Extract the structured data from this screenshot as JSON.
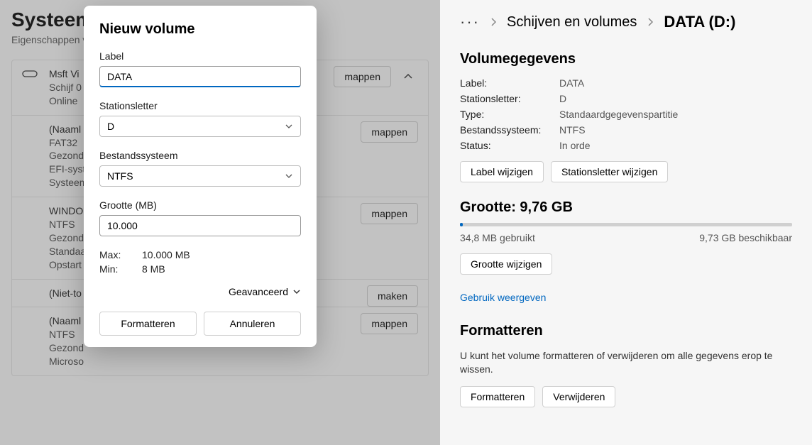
{
  "left": {
    "title": "Systeem                           volumes",
    "subtitle": "Eigenschappen v",
    "disks": [
      {
        "name": "Msft Vi",
        "lines": [
          "Schijf 0",
          "Online"
        ],
        "action": "mappen",
        "expandable": true,
        "icon": true
      },
      {
        "name": "(Naaml",
        "lines": [
          "FAT32",
          "Gezond",
          "EFI-syst",
          "Systeem"
        ],
        "action": "mappen"
      },
      {
        "name": "WINDO",
        "lines": [
          "NTFS",
          "Gezond",
          "Standaa",
          "Opstart"
        ],
        "action": "mappen"
      },
      {
        "name": "(Niet-to",
        "lines": [],
        "action": "maken"
      },
      {
        "name": "(Naaml",
        "lines": [
          "NTFS",
          "Gezond",
          "Microso"
        ],
        "action": "mappen"
      }
    ]
  },
  "dialog": {
    "title": "Nieuw volume",
    "label_field": "Label",
    "label_value": "DATA",
    "letter_field": "Stationsletter",
    "letter_value": "D",
    "fs_field": "Bestandssysteem",
    "fs_value": "NTFS",
    "size_field": "Grootte (MB)",
    "size_value": "10.000",
    "max_label": "Max:",
    "max_value": "10.000 MB",
    "min_label": "Min:",
    "min_value": "8 MB",
    "advanced": "Geavanceerd",
    "format_btn": "Formatteren",
    "cancel_btn": "Annuleren"
  },
  "right": {
    "breadcrumb_mid": "Schijven en volumes",
    "breadcrumb_current": "DATA (D:)",
    "volume_section": "Volumegegevens",
    "props": {
      "label_k": "Label:",
      "label_v": "DATA",
      "letter_k": "Stationsletter:",
      "letter_v": "D",
      "type_k": "Type:",
      "type_v": "Standaardgegevenspartitie",
      "fs_k": "Bestandssysteem:",
      "fs_v": "NTFS",
      "status_k": "Status:",
      "status_v": "In orde"
    },
    "change_label": "Label wijzigen",
    "change_letter": "Stationsletter wijzigen",
    "size_title": "Grootte: 9,76 GB",
    "used": "34,8 MB gebruikt",
    "free": "9,73 GB beschikbaar",
    "change_size": "Grootte wijzigen",
    "show_usage": "Gebruik weergeven",
    "format_section": "Formatteren",
    "format_desc": "U kunt het volume formatteren of verwijderen om alle gegevens erop te wissen.",
    "format_btn": "Formatteren",
    "delete_btn": "Verwijderen"
  }
}
